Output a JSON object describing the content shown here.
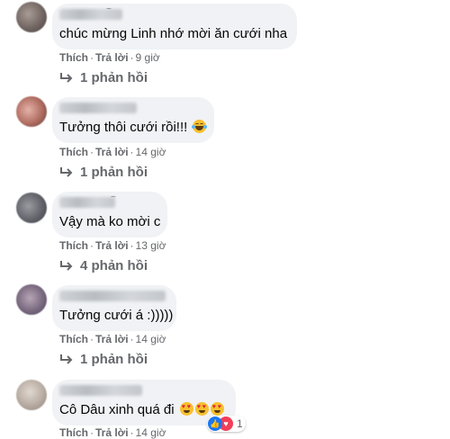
{
  "colors": {
    "bubble": "#f0f2f5",
    "meta_text": "#65676b",
    "body_text": "#050505",
    "like_blue": "#1877f2",
    "love_red": "#f33e58"
  },
  "comments": [
    {
      "name_mark": "~",
      "text": "chúc mừng Linh nhớ mời ăn cưới nha",
      "like": "Thích",
      "reply": "Trả lời",
      "time": "9 giờ",
      "replies": "1 phản hồi"
    },
    {
      "name_mark": "",
      "text": "Tưởng thôi cưới rồi!!!",
      "emoji": "face-with-tears-of-joy",
      "like": "Thích",
      "reply": "Trả lời",
      "time": "14 giờ",
      "replies": "1 phản hồi"
    },
    {
      "name_mark": "~",
      "text": "Vậy mà ko mời c",
      "like": "Thích",
      "reply": "Trả lời",
      "time": "13 giờ",
      "replies": "4 phản hồi"
    },
    {
      "name_mark": "",
      "text": "Tưởng cưới á :)))))",
      "like": "Thích",
      "reply": "Trả lời",
      "time": "14 giờ",
      "replies": "1 phản hồi"
    },
    {
      "name_mark": "",
      "text": "Cô Dâu xinh quá đi",
      "emoji": "heart-eyes x3",
      "like": "Thích",
      "reply": "Trả lời",
      "time": "14 giờ",
      "reaction_count": "1",
      "reaction_icons": [
        "like-icon",
        "love-icon"
      ]
    }
  ]
}
